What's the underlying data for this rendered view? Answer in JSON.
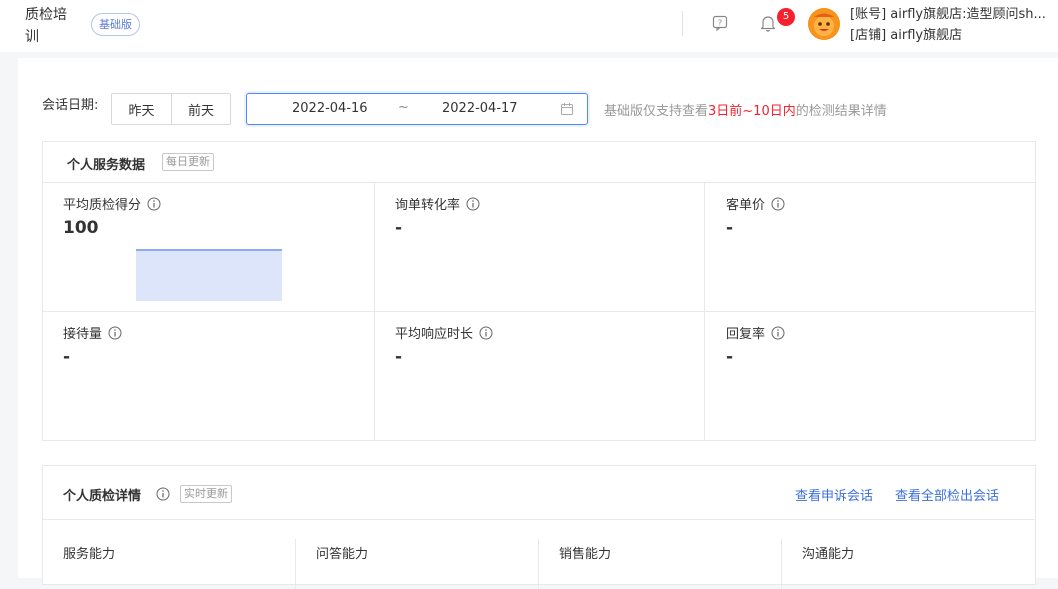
{
  "header": {
    "brand": "质检培训",
    "badge": "基础版",
    "notification_count": "5",
    "account_line": "[账号] airfly旗舰店:造型顾问sh...",
    "shop_line": "[店铺] airfly旗舰店"
  },
  "filter": {
    "date_label": "会话日期:",
    "yesterday_btn": "昨天",
    "day_before_btn": "前天",
    "start_date": "2022-04-16",
    "range_sep": "~",
    "end_date": "2022-04-17",
    "hint_pre": "基础版仅支持查看",
    "hint_highlight": "3日前~10日内",
    "hint_post": "的检测结果详情"
  },
  "service_card": {
    "title": "个人服务数据",
    "tag": "每日更新",
    "metrics": [
      {
        "label": "平均质检得分",
        "value": "100"
      },
      {
        "label": "询单转化率",
        "value": "-"
      },
      {
        "label": "客单价",
        "value": "-"
      },
      {
        "label": "接待量",
        "value": "-"
      },
      {
        "label": "平均响应时长",
        "value": "-"
      },
      {
        "label": "回复率",
        "value": "-"
      }
    ]
  },
  "detail_card": {
    "title": "个人质检详情",
    "tag": "实时更新",
    "link_appeal": "查看申诉会话",
    "link_all": "查看全部检出会话",
    "abilities": [
      "服务能力",
      "问答能力",
      "销售能力",
      "沟通能力"
    ]
  },
  "colors": {
    "accent": "#4c88ff",
    "link": "#3a6fd8",
    "highlight": "#f5222d",
    "sparkline_fill": "#dde5fb",
    "sparkline_line": "#8faaf0"
  }
}
